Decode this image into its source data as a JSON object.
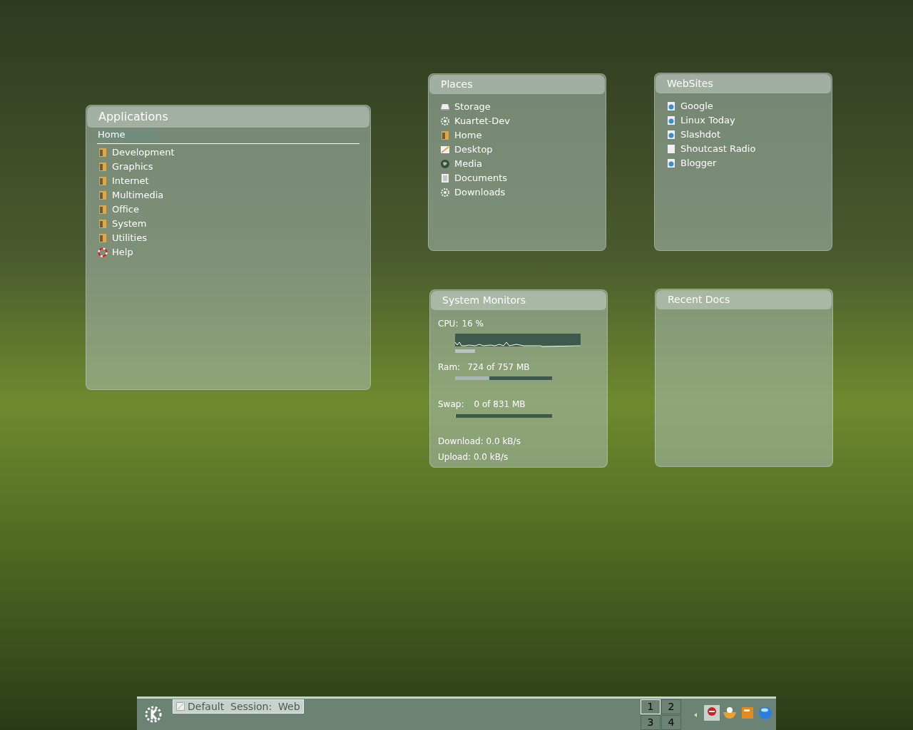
{
  "applications": {
    "title": "Applications",
    "breadcrumb": "Home",
    "items": [
      {
        "label": "Development",
        "kind": "folder"
      },
      {
        "label": "Graphics",
        "kind": "folder"
      },
      {
        "label": "Internet",
        "kind": "folder"
      },
      {
        "label": "Multimedia",
        "kind": "folder"
      },
      {
        "label": "Office",
        "kind": "folder"
      },
      {
        "label": "System",
        "kind": "folder"
      },
      {
        "label": "Utilities",
        "kind": "folder"
      },
      {
        "label": "Help",
        "kind": "help"
      }
    ]
  },
  "places": {
    "title": "Places",
    "items": [
      {
        "label": "Storage",
        "kind": "drive"
      },
      {
        "label": "Kuartet-Dev",
        "kind": "gear"
      },
      {
        "label": "Home",
        "kind": "folder"
      },
      {
        "label": "Desktop",
        "kind": "desktop"
      },
      {
        "label": "Media",
        "kind": "globe"
      },
      {
        "label": "Documents",
        "kind": "document"
      },
      {
        "label": "Downloads",
        "kind": "gear"
      }
    ]
  },
  "websites": {
    "title": "WebSites",
    "items": [
      {
        "label": "Google",
        "kind": "web"
      },
      {
        "label": "Linux Today",
        "kind": "web"
      },
      {
        "label": "Slashdot",
        "kind": "web"
      },
      {
        "label": "Shoutcast Radio",
        "kind": "blank"
      },
      {
        "label": "Blogger",
        "kind": "web"
      }
    ]
  },
  "system_monitors": {
    "title": "System Monitors",
    "cpu": {
      "label": "CPU:",
      "reading": "16 %",
      "level": 0.16
    },
    "ram": {
      "label": "Ram:",
      "reading": "724 of 757 MB",
      "level": 0.35
    },
    "swap": {
      "label": "Swap:",
      "reading": "0 of 831 MB",
      "level": 0
    },
    "download": "Download: 0.0 kB/s",
    "upload": "Upload: 0.0 kB/s"
  },
  "recent_docs": {
    "title": "Recent Docs"
  },
  "taskbar": {
    "task": "Default  Session:  Web",
    "desktops": [
      {
        "label": "1",
        "selected": true
      },
      {
        "label": "2",
        "selected": false
      },
      {
        "label": "3",
        "selected": false
      },
      {
        "label": "4",
        "selected": false
      }
    ]
  }
}
